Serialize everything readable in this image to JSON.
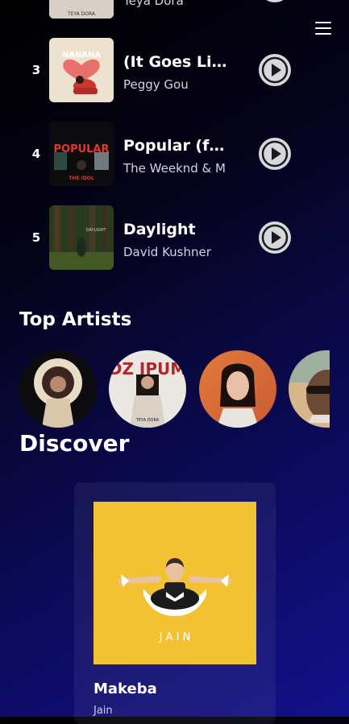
{
  "header": {
    "menu_icon": "hamburger-menu-icon"
  },
  "tracks": [
    {
      "rank": "",
      "title": "",
      "artist": "Teya Dora"
    },
    {
      "rank": "3",
      "title": "(It Goes Like Nanana)",
      "artist": "Peggy Gou"
    },
    {
      "rank": "4",
      "title": "Popular (feat. Playboi Carti)",
      "artist": "The Weeknd & M"
    },
    {
      "rank": "5",
      "title": "Daylight",
      "artist": "David Kushner"
    }
  ],
  "top_artists": {
    "title": "Top Artists"
  },
  "discover": {
    "title": "Discover",
    "card": {
      "song": "Makeba",
      "artist": "Jain",
      "cover_text": "J A I N"
    }
  },
  "covers": {
    "nanana_text": "NANANA",
    "popular_text": "POPULAR",
    "popular_sub": "THE IDOL",
    "teya_text": "TEYA DORA",
    "daylight_text": "DAYLIGHT"
  },
  "colors": {
    "play_button": "#d7d7de",
    "discover_cover": "#f2c232",
    "background_end": "#12108a"
  }
}
